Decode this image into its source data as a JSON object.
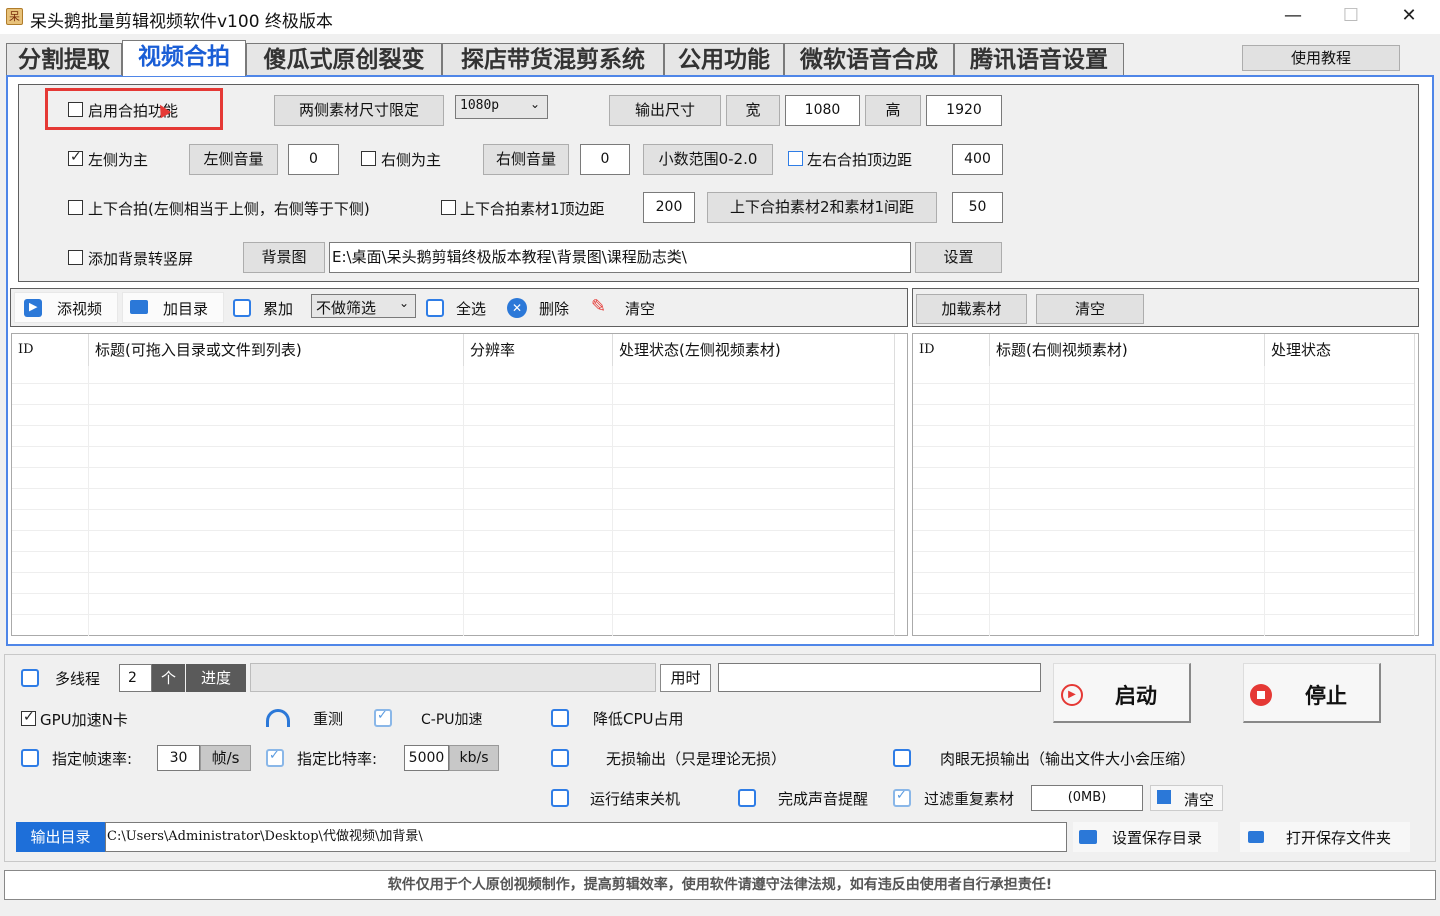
{
  "window": {
    "title": "呆头鹅批量剪辑视频软件v100 终极版本",
    "icon": "goose-app-icon",
    "minimize": "—",
    "maximize": "☐",
    "close": "✕"
  },
  "tabs": [
    "分割提取",
    "视频合拍",
    "傻瓜式原创裂变",
    "探店带货混剪系统",
    "公用功能",
    "微软语音合成",
    "腾讯语音设置"
  ],
  "tutorial_button": "使用教程",
  "settings": {
    "enable_collab": "启用合拍功能",
    "size_limit_button": "两侧素材尺寸限定",
    "size_select": "1080p",
    "output_size_button": "输出尺寸",
    "width_label": "宽",
    "width_value": "1080",
    "height_label": "高",
    "height_value": "1920",
    "left_main": "左侧为主",
    "left_volume_button": "左侧音量",
    "left_volume_value": "0",
    "right_main": "右侧为主",
    "right_volume_button": "右侧音量",
    "right_volume_value": "0",
    "decimal_range_button": "小数范围0-2.0",
    "lr_top_margin_label": "左右合拍顶边距",
    "lr_top_margin_value": "400",
    "tb_collab_label": "上下合拍(左侧相当于上侧，右侧等于下侧)",
    "tb_top_margin_label": "上下合拍素材1顶边距",
    "tb_top_margin_value": "200",
    "tb_gap_button": "上下合拍素材2和素材1间距",
    "tb_gap_value": "50",
    "bg_portrait_label": "添加背景转竖屏",
    "bg_image_button": "背景图",
    "bg_path": "E:\\桌面\\呆头鹅剪辑终极版本教程\\背景图\\课程励志类\\",
    "set_button": "设置"
  },
  "toolbar_left": {
    "add_video": "添视频",
    "add_dir": "加目录",
    "accumulate": "累加",
    "filter_select": "不做筛选",
    "select_all": "全选",
    "delete": "删除",
    "clear": "清空"
  },
  "toolbar_right": {
    "load_material": "加载素材",
    "clear": "清空"
  },
  "table_left": {
    "columns": [
      "ID",
      "标题(可拖入目录或文件到列表)",
      "分辨率",
      "处理状态(左侧视频素材)"
    ]
  },
  "table_right": {
    "columns": [
      "ID",
      "标题(右侧视频素材)",
      "处理状态"
    ]
  },
  "bottom": {
    "multithread": "多线程",
    "thread_value": "2",
    "thread_unit": "个",
    "progress_label": "进度",
    "progress_value": 0,
    "time_label": "用时",
    "time_value": "",
    "start": "启动",
    "stop": "停止",
    "gpu_accel": "GPU加速N卡",
    "retest": "重测",
    "cpu_accel": "C-PU加速",
    "reduce_cpu": "降低CPU占用",
    "fps_label": "指定帧速率:",
    "fps_value": "30",
    "fps_unit": "帧/s",
    "bitrate_label": "指定比特率:",
    "bitrate_value": "5000",
    "bitrate_unit": "kb/s",
    "lossless": "无损输出（只是理论无损）",
    "visual_lossless": "肉眼无损输出（输出文件大小会压缩）",
    "shutdown": "运行结束关机",
    "sound_notify": "完成声音提醒",
    "filter_duplicate": "过滤重复素材",
    "dup_value": "(0MB)",
    "dup_clear": "清空",
    "output_dir_label": "输出目录",
    "output_dir": "C:\\Users\\Administrator\\Desktop\\代做视频\\加背景\\",
    "set_save_dir": "设置保存目录",
    "open_save_folder": "打开保存文件夹"
  },
  "footer": "软件仅用于个人原创视频制作，提高剪辑效率，使用软件请遵守法律法规，如有违反由使用者自行承担责任!",
  "colors": {
    "accent": "#1a5ed6",
    "highlight_red": "#e53935",
    "output_dir_bg": "#1e6fd9",
    "checkbox_blue": "#2f7de6"
  }
}
